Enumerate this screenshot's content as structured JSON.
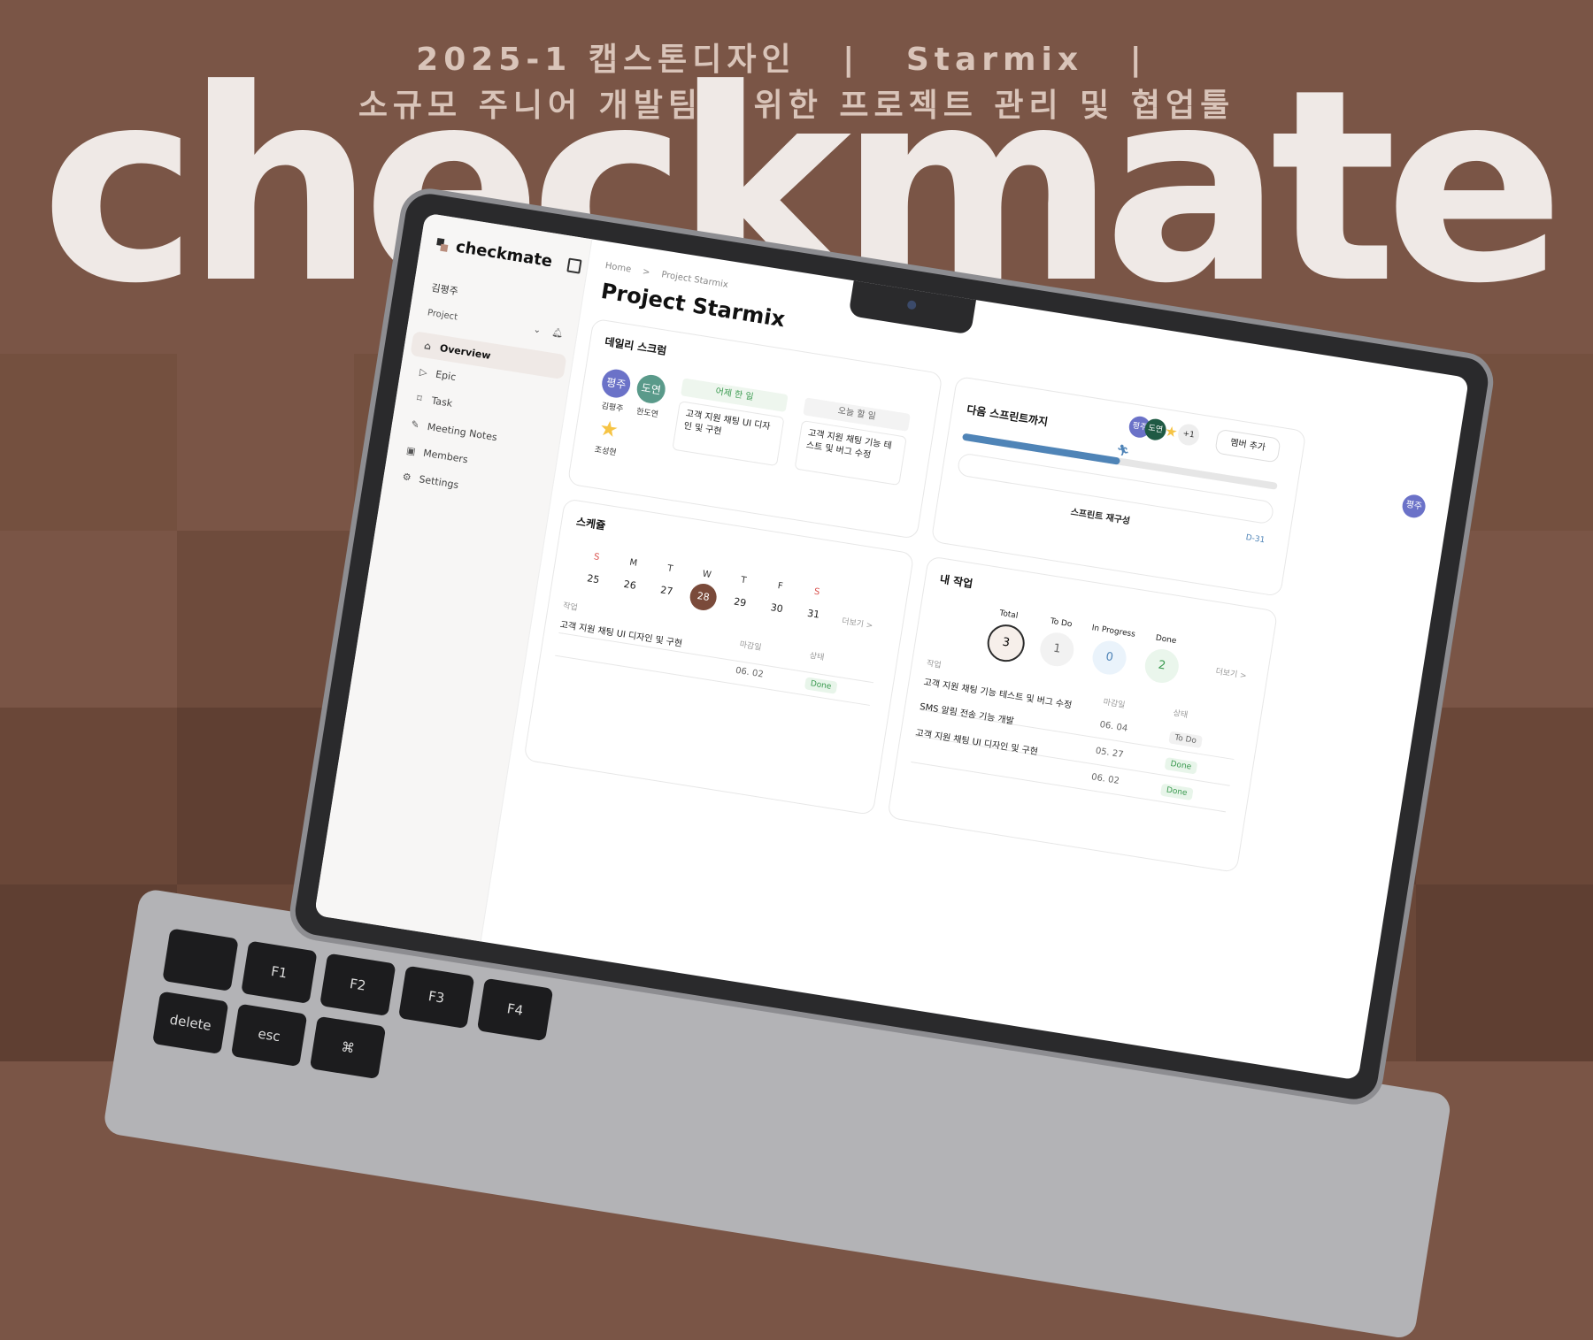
{
  "header": {
    "course": "2025-1 캡스톤디자인",
    "team": "Starmix",
    "tagline": "소규모 주니어 개발팀을 위한 프로젝트 관리 및 협업툴",
    "separator": "|"
  },
  "wordmark": "checkmate",
  "colors": {
    "background": "#7a5546",
    "wordmark": "#efe9e6",
    "accent_brown": "#7a4a3a",
    "progress": "#4f84b7",
    "done_green": "#3a9a4f"
  },
  "app": {
    "brand": "checkmate",
    "user": "김평주",
    "sidebar": {
      "project_label": "Project",
      "items": [
        {
          "label": "Overview",
          "icon": "home-icon",
          "active": true
        },
        {
          "label": "Epic",
          "icon": "play-icon",
          "active": false
        },
        {
          "label": "Task",
          "icon": "bookmark-icon",
          "active": false
        },
        {
          "label": "Meeting Notes",
          "icon": "note-icon",
          "active": false
        },
        {
          "label": "Members",
          "icon": "members-icon",
          "active": false
        },
        {
          "label": "Settings",
          "icon": "gear-icon",
          "active": false
        }
      ]
    },
    "breadcrumb": {
      "home": "Home",
      "sep": ">",
      "current": "Project Starmix"
    },
    "title": "Project Starmix",
    "me_avatar": "평주",
    "scrum": {
      "title": "데일리 스크럼",
      "members": [
        {
          "initials": "평주",
          "name": "김평주",
          "color": "#6b72c8"
        },
        {
          "initials": "도연",
          "name": "한도연",
          "color": "#5a9a8a"
        },
        {
          "initials": "★",
          "name": "조성현",
          "color": "#f6c445"
        }
      ],
      "yesterday_label": "어제 한 일",
      "yesterday_text": "고객 지원 채팅 UI 디자인 및 구현",
      "today_label": "오늘 할 일",
      "today_text": "고객 지원 채팅 기능 테스트 및 버그 수정"
    },
    "sprint": {
      "title": "다음 스프린트까지",
      "avatars": [
        "평주",
        "도연",
        "★",
        "+1"
      ],
      "add_member": "멤버 추가",
      "progress": 0.5,
      "runner_icon": "runner-icon",
      "reset_label": "스프린트 재구성",
      "dday": "D-31"
    },
    "schedule": {
      "title": "스케쥴",
      "more": "더보기 >",
      "days": [
        "S",
        "M",
        "T",
        "W",
        "T",
        "F",
        "S"
      ],
      "dates": [
        "25",
        "26",
        "27",
        "28",
        "29",
        "30",
        "31"
      ],
      "today_index": 3,
      "col_task": "작업",
      "col_due": "마감일",
      "col_status": "상태",
      "rows": [
        {
          "task": "고객 지원 채팅 UI 디자인 및 구현",
          "due": "06. 02",
          "status": "Done"
        }
      ]
    },
    "mywork": {
      "title": "내 작업",
      "more": "더보기 >",
      "stats": [
        {
          "label": "Total",
          "value": "3"
        },
        {
          "label": "To Do",
          "value": "1"
        },
        {
          "label": "In Progress",
          "value": "0"
        },
        {
          "label": "Done",
          "value": "2"
        }
      ],
      "col_task": "작업",
      "col_due": "마감일",
      "col_status": "상태",
      "rows": [
        {
          "task": "고객 지원 채팅 기능 테스트 및 버그 수정",
          "due": "06. 04",
          "status": "To Do"
        },
        {
          "task": "SMS 알림 전송 기능 개발",
          "due": "05. 27",
          "status": "Done"
        },
        {
          "task": "고객 지원 채팅 UI 디자인 및 구현",
          "due": "06. 02",
          "status": "Done"
        }
      ]
    },
    "keyboard": [
      "",
      "F1",
      "F2",
      "F3",
      "F4",
      "delete",
      "esc",
      "⌘"
    ]
  }
}
